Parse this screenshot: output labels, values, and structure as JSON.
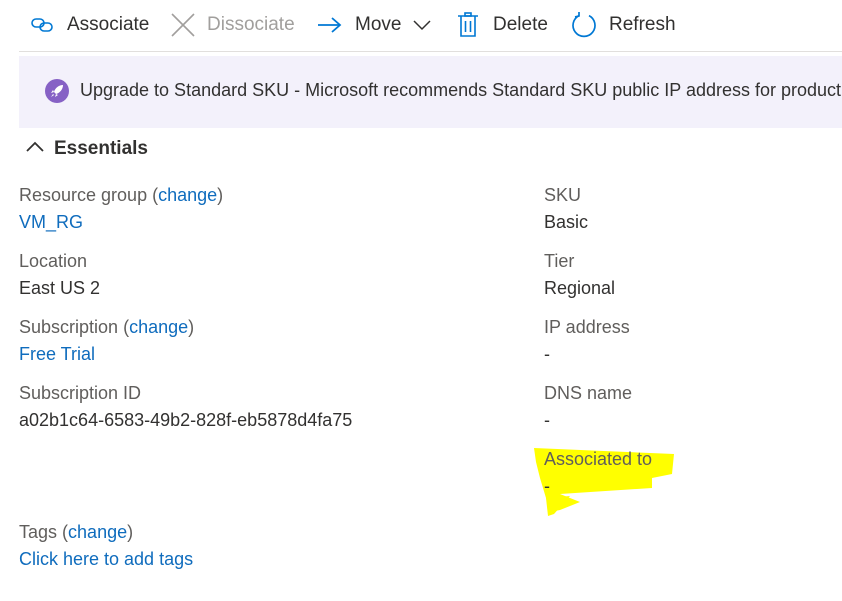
{
  "toolbar": {
    "associate_label": "Associate",
    "dissociate_label": "Dissociate",
    "move_label": "Move",
    "delete_label": "Delete",
    "refresh_label": "Refresh"
  },
  "banner": {
    "text": "Upgrade to Standard SKU - Microsoft recommends Standard SKU public IP address for productio"
  },
  "essentials": {
    "title": "Essentials",
    "resource_group": {
      "label": "Resource group",
      "change_open": "(",
      "change": "change",
      "change_close": ")",
      "value": "VM_RG"
    },
    "location": {
      "label": "Location",
      "value": "East US 2"
    },
    "subscription": {
      "label": "Subscription",
      "change_open": "(",
      "change": "change",
      "change_close": ")",
      "value": "Free Trial"
    },
    "subscription_id": {
      "label": "Subscription ID",
      "value": "a02b1c64-6583-49b2-828f-eb5878d4fa75"
    },
    "sku": {
      "label": "SKU",
      "value": "Basic"
    },
    "tier": {
      "label": "Tier",
      "value": "Regional"
    },
    "ip_address": {
      "label": "IP address",
      "value": "-"
    },
    "dns_name": {
      "label": "DNS name",
      "value": "-"
    },
    "associated_to": {
      "label": "Associated to",
      "value": "-"
    },
    "tags": {
      "label": "Tags",
      "change_open": "(",
      "change": "change",
      "change_close": ")",
      "add_link": "Click here to add tags"
    }
  },
  "colors": {
    "link": "#0f6cbd",
    "accent": "#0078d4",
    "banner_bg": "#f3f1fb",
    "banner_icon": "#8661c5",
    "highlight": "#ffff00"
  },
  "icons": {
    "associate": "link-icon",
    "dissociate": "x-icon",
    "move": "arrow-right-icon",
    "move_menu": "chevron-down-icon",
    "delete": "trash-icon",
    "refresh": "refresh-icon",
    "banner": "rocket-icon",
    "essentials_toggle": "chevron-up-icon"
  }
}
